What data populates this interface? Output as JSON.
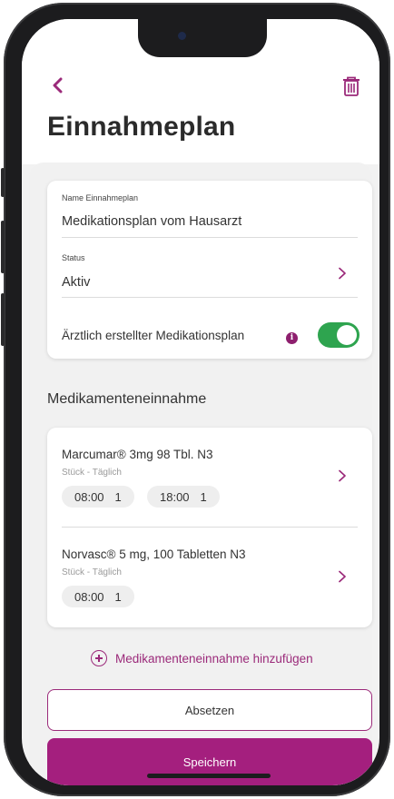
{
  "header": {
    "title": "Einnahmeplan",
    "back_icon": "chevron-left-icon",
    "delete_icon": "trash-icon"
  },
  "plan": {
    "name_label": "Name Einnahmeplan",
    "name_value": "Medikationsplan vom Hausarzt",
    "status_label": "Status",
    "status_value": "Aktiv",
    "doctor_label": "Ärztlich erstellter Medikationsplan",
    "info_glyph": "i",
    "doctor_toggle_on": true
  },
  "medications": {
    "section_title": "Medikamenteneinnahme",
    "items": [
      {
        "name": "Marcumar® 3mg 98 Tbl. N3",
        "schedule": "Stück - Täglich",
        "doses": [
          {
            "time": "08:00",
            "qty": "1"
          },
          {
            "time": "18:00",
            "qty": "1"
          }
        ]
      },
      {
        "name": "Norvasc® 5 mg, 100 Tabletten N3",
        "schedule": "Stück - Täglich",
        "doses": [
          {
            "time": "08:00",
            "qty": "1"
          }
        ]
      }
    ],
    "add_label": "Medikamenteneinnahme hinzufügen"
  },
  "actions": {
    "discontinue_label": "Absetzen",
    "save_label": "Speichern"
  },
  "colors": {
    "accent": "#a41f7e",
    "toggle_on": "#2ea44f",
    "background": "#f1f1f1"
  }
}
